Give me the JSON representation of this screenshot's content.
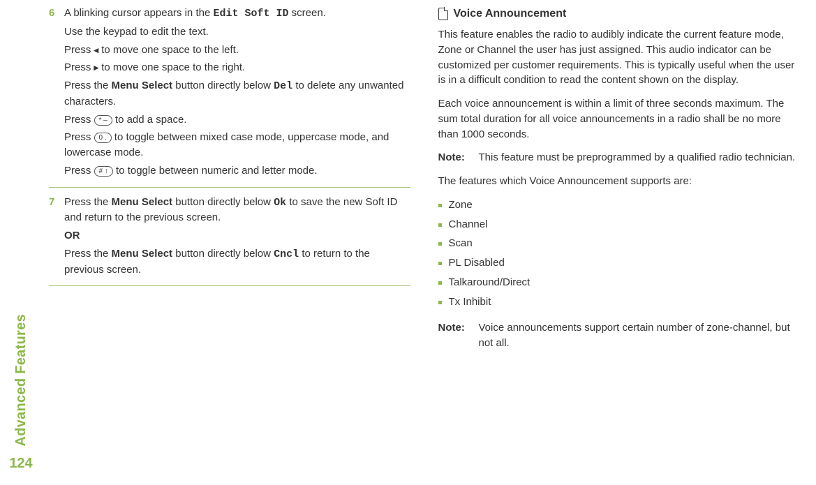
{
  "sidebar": {
    "label": "Advanced Features",
    "page_num": "124"
  },
  "left": {
    "step6": {
      "num": "6",
      "line1a": "A blinking cursor appears in the ",
      "line1b": "Edit Soft ID",
      "line1c": " screen.",
      "line2": "Use the keypad to edit the text.",
      "line3a": "Press ",
      "line3b": " to move one space to the left.",
      "line4a": "Press ",
      "line4b": " to move one space to the right.",
      "line5a": "Press the ",
      "line5b": "Menu Select",
      "line5c": " button directly below ",
      "line5d": "Del",
      "line5e": " to delete any unwanted characters.",
      "line6a": "Press ",
      "line6key": "* –",
      "line6b": " to add a space.",
      "line7a": "Press ",
      "line7key": "0 .",
      "line7b": " to toggle between mixed case mode, uppercase mode, and lowercase mode.",
      "line8a": "Press ",
      "line8key": "# ↑",
      "line8b": " to toggle between numeric and letter mode."
    },
    "step7": {
      "num": "7",
      "line1a": "Press the ",
      "line1b": "Menu Select",
      "line1c": " button directly below ",
      "line1d": "Ok",
      "line1e": " to save the new Soft ID and return to the previous screen.",
      "or": "OR",
      "line2a": "Press the ",
      "line2b": "Menu Select",
      "line2c": " button directly below ",
      "line2d": "Cncl",
      "line2e": " to return to the previous screen."
    }
  },
  "right": {
    "section_title": "Voice Announcement",
    "para1": "This feature enables the radio to audibly indicate the current feature mode, Zone or Channel the user has just assigned. This audio indicator can be customized per customer requirements. This is typically useful when the user is in a difficult condition to read the content shown on the display.",
    "para2": "Each voice announcement is within a limit of three seconds maximum. The sum total duration for all voice announcements in a radio shall be no more than 1000 seconds.",
    "note1_label": "Note:",
    "note1_body": "This feature must be preprogrammed by a qualified radio technician.",
    "para3": "The features which Voice Announcement supports are:",
    "bullets": [
      "Zone",
      "Channel",
      "Scan",
      "PL Disabled",
      "Talkaround/Direct",
      "Tx Inhibit"
    ],
    "note2_label": "Note:",
    "note2_body": "Voice announcements support certain number of zone-channel, but not all."
  },
  "arrows": {
    "left": "◂",
    "right": "▸"
  }
}
